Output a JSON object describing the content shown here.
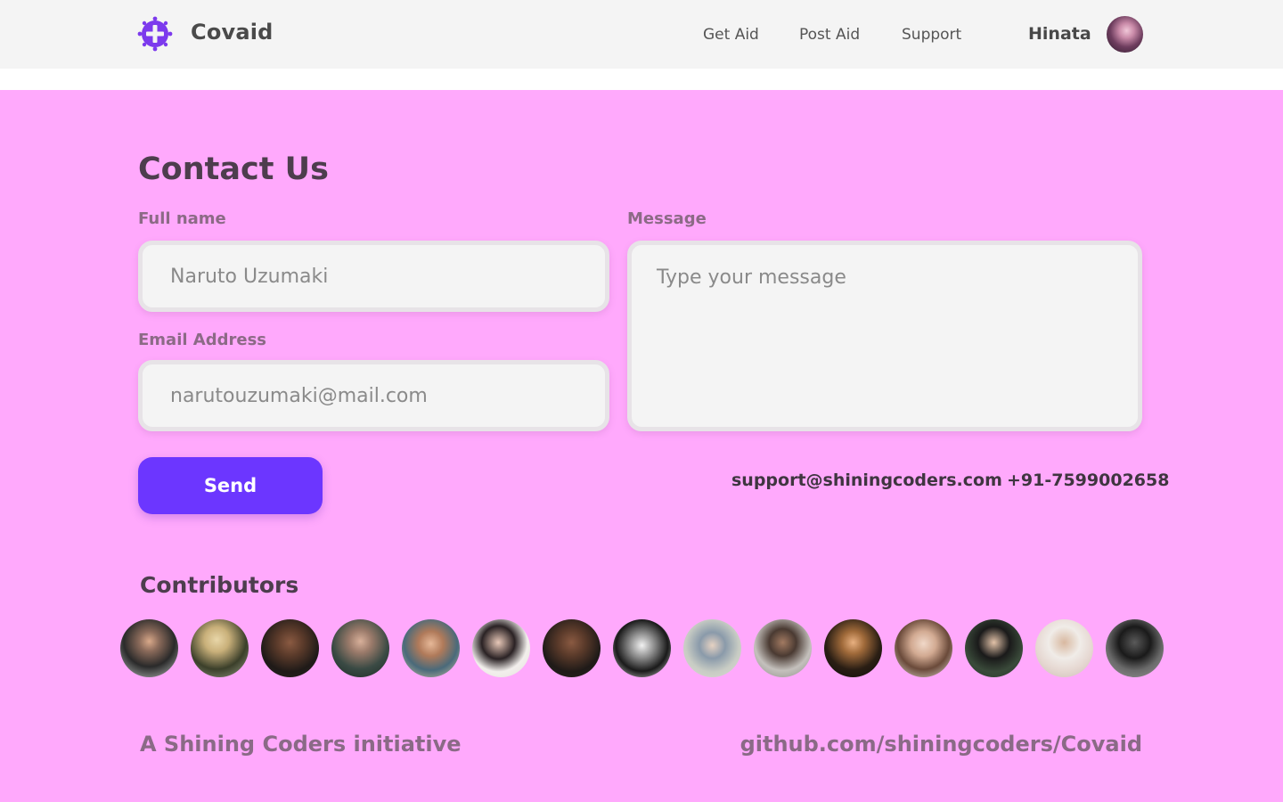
{
  "header": {
    "brand": "Covaid",
    "nav": [
      "Get Aid",
      "Post Aid",
      "Support"
    ],
    "username": "Hinata",
    "logo_icon": "virus-cross-icon"
  },
  "contact": {
    "title": "Contact Us",
    "full_name_label": "Full name",
    "full_name_placeholder": "Naruto Uzumaki",
    "email_label": "Email Address",
    "email_placeholder": "narutouzumaki@mail.com",
    "message_label": "Message",
    "message_placeholder": "Type your message",
    "send_label": "Send",
    "support_email": "support@shiningcoders.com",
    "support_phone": "+91-7599002658"
  },
  "contributors": {
    "title": "Contributors",
    "count": 15
  },
  "footer": {
    "initiative": "A Shining Coders initiative",
    "repo": "github.com/shiningcoders/Covaid"
  },
  "colors": {
    "background": "#ffa9fc",
    "header_bg": "#f4f4f4",
    "accent": "#6c36ff",
    "logo": "#7c3aed"
  }
}
